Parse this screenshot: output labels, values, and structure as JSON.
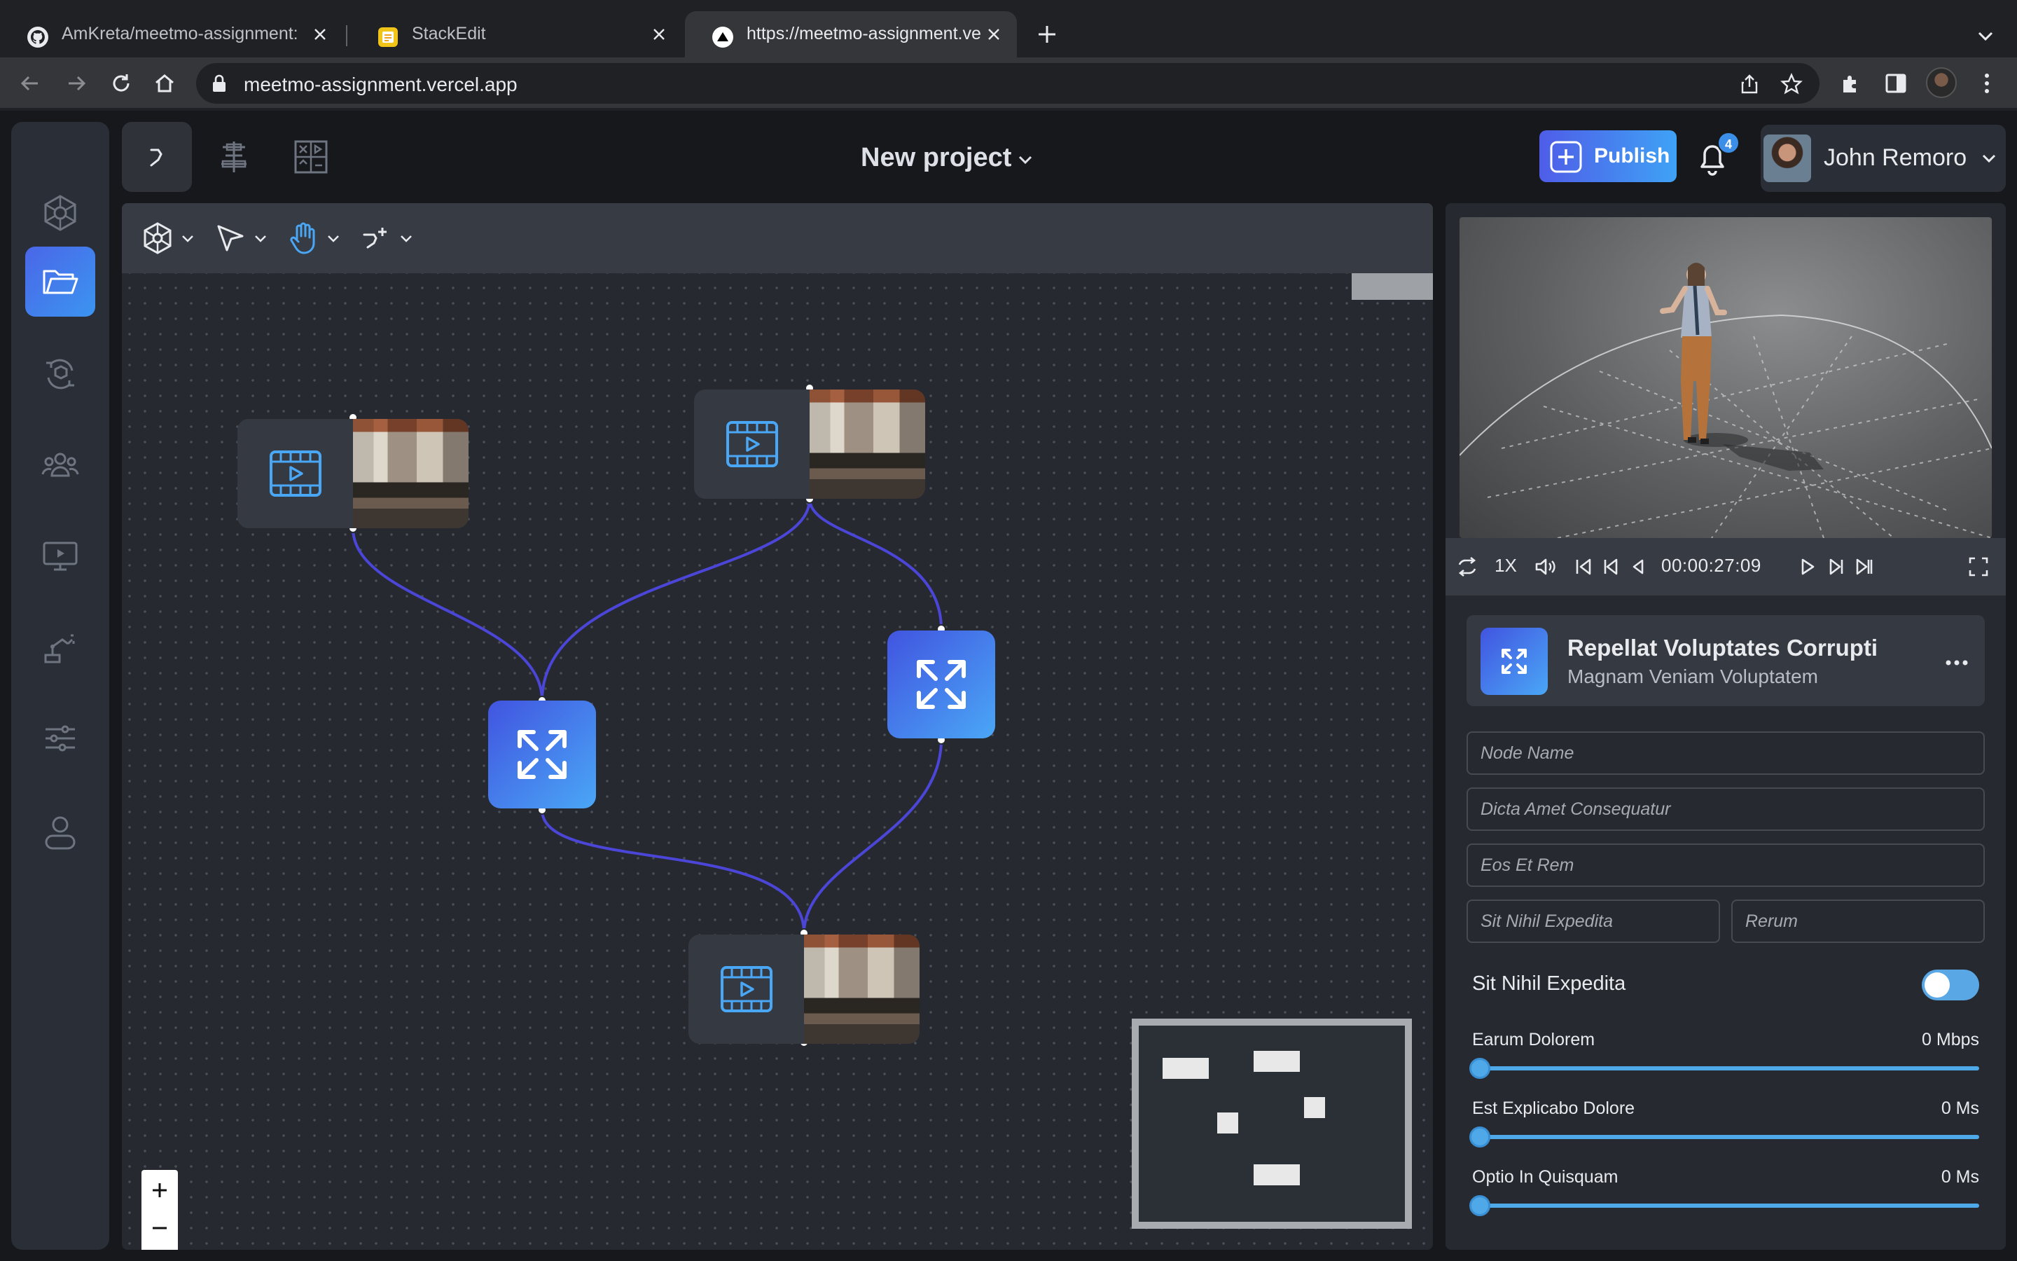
{
  "browser": {
    "tabs": [
      {
        "label": "AmKreta/meetmo-assignment: A",
        "favicon": "github-icon"
      },
      {
        "label": "StackEdit",
        "favicon": "stackedit-icon"
      },
      {
        "label": "https://meetmo-assignment.ve",
        "favicon": "vercel-icon"
      }
    ],
    "url": "meetmo-assignment.vercel.app"
  },
  "topbar": {
    "project_title": "New project",
    "publish_label": "Publish",
    "notification_count": "4",
    "user_name": "John Remoro"
  },
  "leftnav": {
    "items": [
      "network-icon",
      "folder-icon",
      "cube-refresh-icon",
      "team-icon",
      "presentation-icon",
      "robot-arm-icon",
      "sliders-icon",
      "user-icon"
    ],
    "active": "folder-icon"
  },
  "player": {
    "speed": "1X",
    "timecode": "00:00:27:09"
  },
  "node": {
    "title": "Repellat Voluptates Corrupti",
    "subtitle": "Magnam Veniam Voluptatem"
  },
  "form": {
    "node_name_placeholder": "Node Name",
    "field2_placeholder": "Dicta Amet Consequatur",
    "field3_placeholder": "Eos Et Rem",
    "field4_placeholder": "Sit Nihil Expedita",
    "field5_placeholder": "Rerum",
    "toggle_label": "Sit Nihil Expedita",
    "toggle_on": true
  },
  "sliders": [
    {
      "label": "Earum Dolorem",
      "value": "0 Mbps",
      "level": 0
    },
    {
      "label": "Est Explicabo Dolore",
      "value": "0 Ms",
      "level": 0
    },
    {
      "label": "Optio In Quisquam",
      "value": "0 Ms",
      "level": 0
    }
  ],
  "colors": {
    "accent_start": "#4154e0",
    "accent_end": "#4aa7f6",
    "edge": "#4b46d8"
  }
}
